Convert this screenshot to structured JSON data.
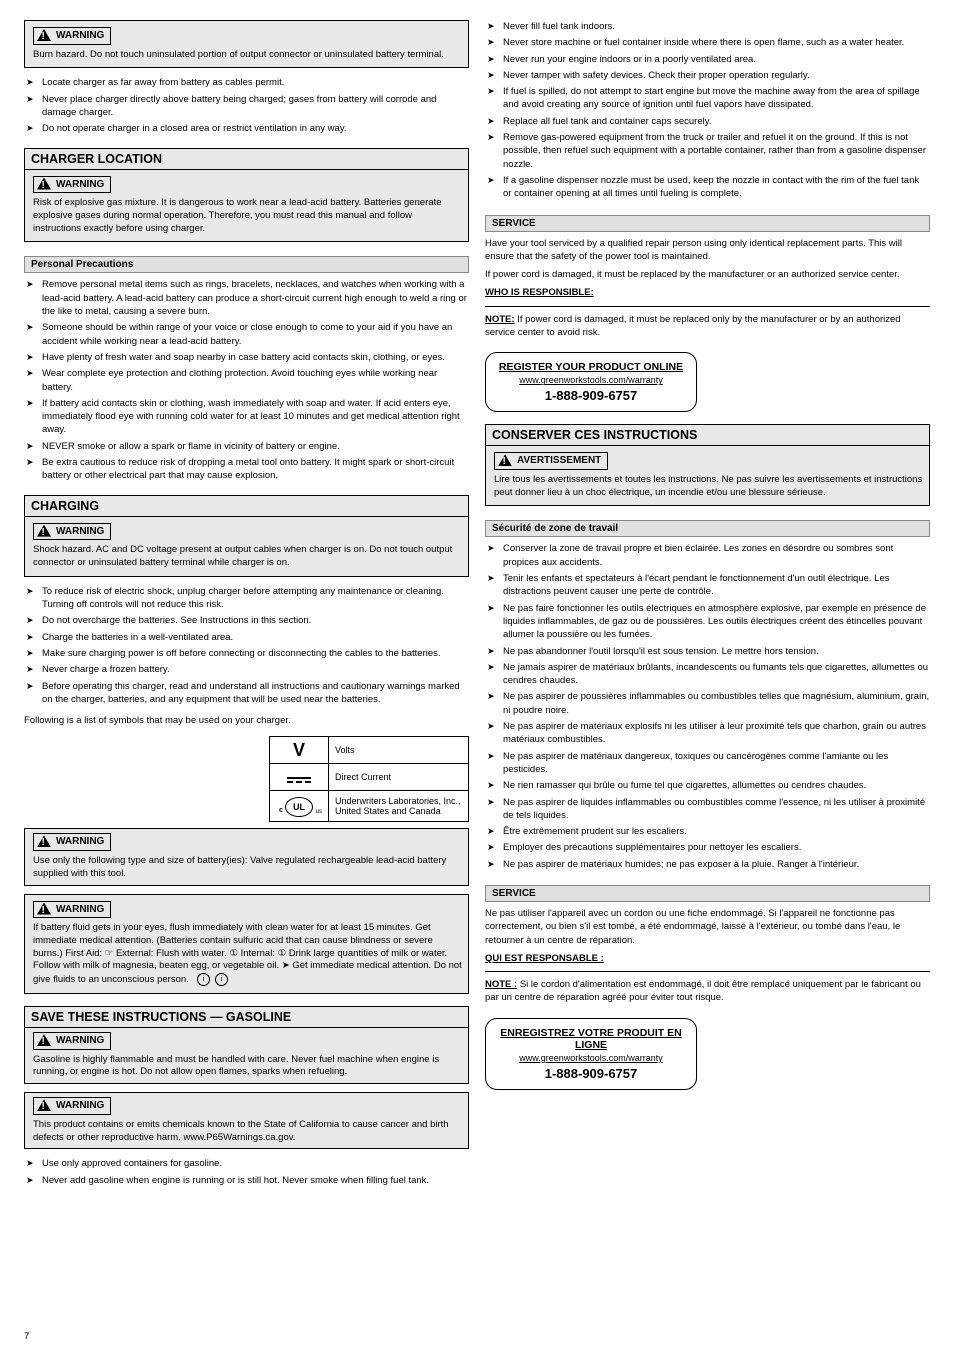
{
  "footer": "7",
  "left": {
    "warn_burn": {
      "label": "WARNING",
      "text": "Burn hazard. Do not touch uninsulated portion of output connector or uninsulated battery terminal."
    },
    "inst_precaution_bullets": [
      "Locate charger as far away from battery as cables permit.",
      "Never place charger directly above battery being charged;  gases from battery will corrode and damage charger.",
      "Do not operate charger in a closed area or restrict ventilation in any way."
    ],
    "sect_charger_loc_title": "CHARGER LOCATION",
    "warn_explosion1": {
      "label": "WARNING",
      "text": "Risk of explosive gas mixture. It is dangerous to work near a lead-acid battery. Batteries generate explosive gases during normal operation. Therefore, you must read this manual and follow instructions exactly before using charger."
    },
    "sub_personal_title": "Personal Precautions",
    "personal_bullets": [
      "Remove personal metal items such as rings, bracelets, necklaces, and watches when working with a lead-acid battery. A lead-acid battery can produce a short-circuit current high enough to weld a ring or the like to metal, causing a severe burn.",
      "Someone should be within range of your voice or close enough to come to your aid if you have an accident while working near a lead-acid battery.",
      "Have plenty of fresh water and soap nearby in case battery acid contacts skin, clothing, or eyes.",
      "Wear complete eye protection and clothing protection. Avoid touching eyes while working near battery.",
      "If battery acid contacts skin or clothing, wash immediately with soap and water. If acid enters eye, immediately flood eye with running cold water for at least 10 minutes and get medical attention right away.",
      "NEVER smoke or allow a spark or flame in vicinity of battery or engine.",
      "Be extra cautious to reduce risk of dropping a metal tool onto battery. It might spark or short-circuit battery or other electrical part that may cause explosion."
    ],
    "sect_charging_title": "CHARGING",
    "warn_shock1": {
      "label": "WARNING",
      "text": "Shock hazard. AC and DC voltage present at output cables when charger is on. Do not touch output connector or uninsulated battery terminal while charger is on."
    },
    "charging_bullets": [
      "To reduce risk of electric shock, unplug charger before attempting any maintenance or cleaning. Turning off controls will not reduce this risk.",
      "Do not overcharge the batteries. See Instructions in this section.",
      "Charge the batteries in a well-ventilated area.",
      "Make sure charging power is off before connecting or disconnecting the cables to the batteries.",
      "Never charge a frozen battery.",
      "Before operating this charger, read and understand all instructions and cautionary warnings marked on the charger, batteries, and any equipment that will be used near the batteries."
    ],
    "p_symbols_intro": "Following is a list of symbols that may be used on your charger.",
    "symbols_table": [
      {
        "glyph": "V",
        "desc": "Volts"
      },
      {
        "glyph": "dashes",
        "desc": "Direct Current"
      },
      {
        "glyph": "ul",
        "desc": "Underwriters Laboratories, Inc., United States and Canada"
      }
    ],
    "warn_recharge": {
      "label": "WARNING",
      "text": "Use only the following type and size of battery(ies): Valve regulated rechargeable lead-acid battery supplied with this tool."
    },
    "warn_leak": {
      "label": "WARNING",
      "text": "If battery fluid gets in your eyes, flush immediately with clean water for at least 15 minutes. Get immediate medical attention. (Batteries contain sulfuric acid that can cause blindness or severe burns.) First Aid: ☞ External: Flush with water. ① Internal: ① Drink large quantities of milk or water. Follow with milk of magnesia, beaten egg, or vegetable oil. ➤ Get immediate medical attention. Do not give fluids to an unconscious person."
    },
    "sect_save_gas_title": "SAVE THESE INSTRUCTIONS — GASOLINE",
    "warn_explosion2": {
      "label": "WARNING",
      "text": "Gasoline is highly flammable and must be handled with care. Never fuel machine when engine is running, or engine is hot. Do not allow open flames, sparks when refueling."
    },
    "warn_vapor": {
      "label": "WARNING",
      "text": "This product contains or emits chemicals known to the State of California to cause cancer and birth defects or other reproductive harm. www.P65Warnings.ca.gov."
    },
    "gas_bullets_trail": [
      "Use only approved containers for gasoline.",
      "Never add gasoline when engine is running or is still hot. Never smoke when filling fuel tank."
    ]
  },
  "right": {
    "gas_bullets_cont": [
      "Never fill fuel tank indoors.",
      "Never store machine or fuel container inside where there is open flame, such as a water heater.",
      "Never run your engine indoors or in a poorly ventilated area.",
      "Never tamper with safety devices. Check their proper operation regularly.",
      "If fuel is spilled, do not attempt to start engine but move the machine away from the area of spillage and avoid creating any source of ignition until fuel vapors have dissipated.",
      "Replace all fuel tank and container caps securely.",
      "Remove gas-powered equipment from the truck or trailer and refuel it on the ground. If this is not possible, then refuel such equipment with a portable container, rather than from a gasoline dispenser nozzle.",
      "If a gasoline dispenser nozzle must be used, keep the nozzle in contact with the rim of the fuel tank or container opening at all times until fueling is complete."
    ],
    "sub_service_en_title": "SERVICE",
    "service_en_intro": "Have your tool serviced by a qualified repair person using only identical replacement parts. This will ensure that the safety of the power tool is maintained.",
    "service_en_body1": "If power cord is damaged, it must be replaced by the manufacturer or an authorized service center.",
    "wo_responsible_title": "WHO IS RESPONSIBLE:",
    "note_label": "NOTE:",
    "note_text": " If power cord is damaged, it must be replaced only by the manufacturer or by an authorized service center to avoid risk.",
    "register_en": {
      "title": "REGISTER YOUR PRODUCT ONLINE",
      "url": "www.greenworkstools.com/warranty",
      "phone": "1-888-909-6757"
    },
    "sect_save_fr_title": "CONSERVER CES INSTRUCTIONS",
    "warn_fr1": {
      "label": "AVERTISSEMENT",
      "text": "Lire tous les avertissements et toutes les instructions. Ne pas suivre les avertissements et instructions peut donner lieu à un choc électrique, un incendie et/ou une blessure sérieuse."
    },
    "sub_fr_security_title": "Sécurité de zone de travail",
    "fr_security_bullets": [
      "Conserver la zone de travail propre et bien éclairée. Les zones en désordre ou sombres sont propices aux accidents.",
      "Tenir les enfants et spectateurs à l'écart pendant le fonctionnement d'un outil électrique. Les distractions peuvent causer une perte de contrôle.",
      "Ne pas faire fonctionner les outils électriques en atmosphère explosive, par exemple en présence de liquides inflammables, de gaz ou de poussières. Les outils électriques créent des étincelles pouvant allumer la poussière ou les fumées.",
      "Ne pas abandonner l'outil lorsqu'il est sous tension. Le mettre hors tension.",
      "Ne jamais aspirer de matériaux brûlants, incandescents ou fumants tels que cigarettes, allumettes ou cendres chaudes.",
      "Ne pas aspirer de poussières inflammables ou combustibles telles que magnésium, aluminium, grain, ni poudre noire.",
      "Ne pas aspirer de matériaux explosifs ni les utiliser à leur proximité tels que charbon, grain ou autres matériaux combustibles.",
      "Ne pas aspirer de matériaux dangereux, toxiques ou cancérogènes comme l'amiante ou les pesticides.",
      "Ne rien ramasser qui brûle ou fume tel que cigarettes, allumettes ou cendres chaudes.",
      "Ne pas aspirer de liquides inflammables ou combustibles comme l'essence, ni les utiliser à proximité de tels liquides.",
      "Être extrêmement prudent sur les escaliers.",
      "Employer des précautions supplémentaires pour nettoyer les escaliers.",
      "Ne pas aspirer de matériaux humides; ne pas exposer à la pluie. Ranger à l'intérieur."
    ],
    "sub_service_fr_title": "SERVICE",
    "service_fr_body1": "Ne pas utiliser l'appareil avec un cordon ou une fiche endommagé. Si l'appareil ne fonctionne pas correctement, ou bien s'il est tombé, a été endommagé, laissé à l'extérieur, ou tombé dans l'eau, le retourner à un centre de réparation.",
    "who_fr_title": "QUI EST RESPONSABLE :",
    "note_fr_label": "NOTE :",
    "note_fr_text": " Si le cordon d'alimentation est endommagé, il doit être remplacé uniquement par le fabricant ou par un centre de réparation agréé pour éviter tout risque.",
    "register_fr": {
      "title": "ENREGISTREZ VOTRE PRODUIT EN LIGNE",
      "url": "www.greenworkstools.com/warranty",
      "phone": "1-888-909-6757"
    }
  }
}
